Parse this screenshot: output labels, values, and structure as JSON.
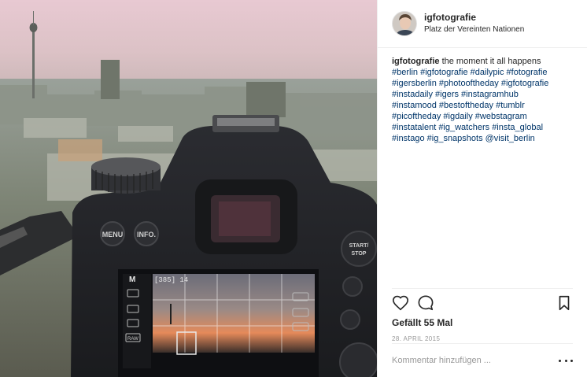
{
  "post": {
    "user": {
      "username": "igfotografie",
      "location": "Platz der Vereinten Nationen",
      "avatar": "user-avatar"
    },
    "caption": {
      "text": "the moment it all happens",
      "hashtag_lines": [
        "#berlin #igfotografie #dailypic #fotografie",
        "#igersberlin #photooftheday #igfotografie",
        "#instadaily #igers #instagramhub",
        "#instamood #bestoftheday #tumblr",
        "#picoftheday #igdaily #webstagram",
        "#instatalent #ig_watchers #insta_global",
        "#instago #ig_snapshots @visit_berlin"
      ]
    },
    "actions": {
      "like_icon": "heart-icon",
      "comment_icon": "comment-icon",
      "save_icon": "bookmark-icon"
    },
    "likes": "Gefällt 55 Mal",
    "date": "28. APRIL 2015",
    "comment_placeholder": "Kommentar hinzufügen ...",
    "more_icon": "more-options-icon"
  },
  "photo": {
    "camera": {
      "menu_label": "MENU",
      "info_label": "INFO.",
      "start_stop_line1": "START/",
      "start_stop_line2": "STOP",
      "lcd_mode": "M",
      "lcd_shots": "[385] 14",
      "lcd_raw": "RAW"
    }
  },
  "colors": {
    "link": "#003569",
    "text": "#262626",
    "muted": "#999999",
    "divider": "#efefef"
  }
}
